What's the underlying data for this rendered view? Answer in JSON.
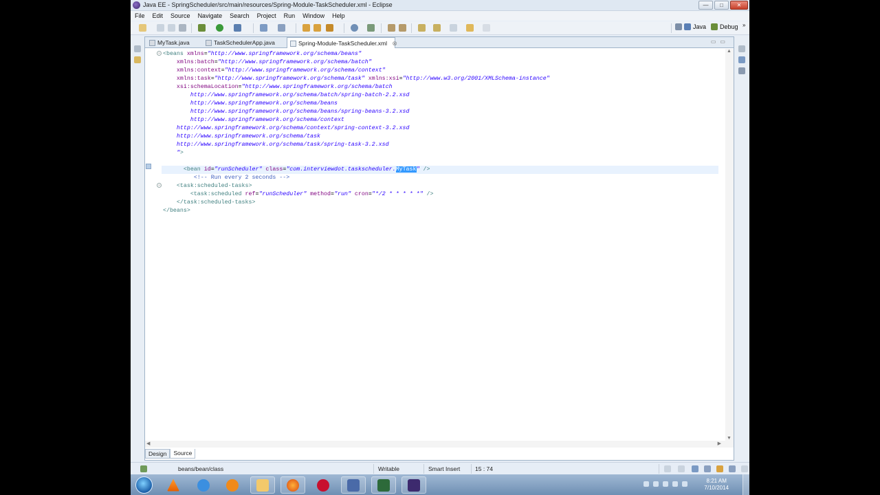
{
  "window": {
    "title": "Java EE - SpringScheduler/src/main/resources/Spring-Module-TaskScheduler.xml - Eclipse",
    "buttons": {
      "minimize": "—",
      "maximize": "□",
      "close": "✕"
    }
  },
  "menu": [
    "File",
    "Edit",
    "Source",
    "Navigate",
    "Search",
    "Project",
    "Run",
    "Window",
    "Help"
  ],
  "perspectives": {
    "java": "Java",
    "debug": "Debug",
    "more": "»"
  },
  "tabs": [
    {
      "label": "MyTask.java"
    },
    {
      "label": "TaskSchedulerApp.java"
    },
    {
      "label": "Spring-Module-TaskScheduler.xml",
      "close": "⊗",
      "active": true
    }
  ],
  "code": {
    "lines": [
      [
        [
          "tag",
          "<beans "
        ],
        [
          "attr",
          "xmlns"
        ],
        [
          "",
          "="
        ],
        [
          "val",
          "\"http://www.springframework.org/schema/beans\""
        ]
      ],
      [
        [
          "",
          "    "
        ],
        [
          "attr",
          "xmlns:batch"
        ],
        [
          "",
          "="
        ],
        [
          "val",
          "\"http://www.springframework.org/schema/batch\""
        ]
      ],
      [
        [
          "",
          "    "
        ],
        [
          "attr",
          "xmlns:context"
        ],
        [
          "",
          "="
        ],
        [
          "val",
          "\"http://www.springframework.org/schema/context\""
        ]
      ],
      [
        [
          "",
          "    "
        ],
        [
          "attr",
          "xmlns:task"
        ],
        [
          "",
          "="
        ],
        [
          "val",
          "\"http://www.springframework.org/schema/task\""
        ],
        [
          "",
          " "
        ],
        [
          "attr",
          "xmlns:xsi"
        ],
        [
          "",
          "="
        ],
        [
          "val",
          "\"http://www.w3.org/2001/XMLSchema-instance\""
        ]
      ],
      [
        [
          "",
          "    "
        ],
        [
          "attr",
          "xsi:schemaLocation"
        ],
        [
          "",
          "="
        ],
        [
          "val",
          "\"http://www.springframework.org/schema/batch"
        ]
      ],
      [
        [
          "",
          "        "
        ],
        [
          "val",
          "http://www.springframework.org/schema/batch/spring-batch-2.2.xsd"
        ]
      ],
      [
        [
          "",
          "        "
        ],
        [
          "val",
          "http://www.springframework.org/schema/beans"
        ]
      ],
      [
        [
          "",
          "        "
        ],
        [
          "val",
          "http://www.springframework.org/schema/beans/spring-beans-3.2.xsd"
        ]
      ],
      [
        [
          "",
          "        "
        ],
        [
          "val",
          "http://www.springframework.org/schema/context"
        ]
      ],
      [
        [
          "",
          "    "
        ],
        [
          "val",
          "http://www.springframework.org/schema/context/spring-context-3.2.xsd"
        ]
      ],
      [
        [
          "",
          "    "
        ],
        [
          "val",
          "http://www.springframework.org/schema/task"
        ]
      ],
      [
        [
          "",
          "    "
        ],
        [
          "val",
          "http://www.springframework.org/schema/task/spring-task-3.2.xsd"
        ]
      ],
      [
        [
          "",
          "    "
        ],
        [
          "val",
          "\""
        ],
        [
          "tag",
          ">"
        ]
      ],
      [],
      [
        [
          "",
          "      "
        ],
        [
          "tag",
          "<bean "
        ],
        [
          "attr",
          "id"
        ],
        [
          "",
          "="
        ],
        [
          "val",
          "\"runScheduler\""
        ],
        [
          "",
          " "
        ],
        [
          "attr",
          "class"
        ],
        [
          "",
          "="
        ],
        [
          "val",
          "\"com.interviewdot.taskscheduler."
        ],
        [
          "sel",
          "MyTask"
        ],
        [
          "val",
          "\""
        ],
        [
          "",
          " "
        ],
        [
          "tag",
          "/>"
        ]
      ],
      [
        [
          "",
          "         "
        ],
        [
          "cmt",
          "<!-- Run every 2 seconds -->"
        ]
      ],
      [
        [
          "",
          "    "
        ],
        [
          "tag",
          "<task:scheduled-tasks>"
        ]
      ],
      [
        [
          "",
          "        "
        ],
        [
          "tag",
          "<task:scheduled "
        ],
        [
          "attr",
          "ref"
        ],
        [
          "",
          "="
        ],
        [
          "val",
          "\"runScheduler\""
        ],
        [
          "",
          " "
        ],
        [
          "attr",
          "method"
        ],
        [
          "",
          "="
        ],
        [
          "val",
          "\"run\""
        ],
        [
          "",
          " "
        ],
        [
          "attr",
          "cron"
        ],
        [
          "",
          "="
        ],
        [
          "val",
          "\"*/2 * * * * *\""
        ],
        [
          "",
          " "
        ],
        [
          "tag",
          "/>"
        ]
      ],
      [
        [
          "",
          "    "
        ],
        [
          "tag",
          "</task:scheduled-tasks>"
        ]
      ],
      [
        [
          "tag",
          "</beans>"
        ]
      ]
    ]
  },
  "editor_modes": [
    "Design",
    "Source"
  ],
  "status": {
    "breadcrumb": "beans/bean/class",
    "mode": "Writable",
    "insert": "Smart Insert",
    "position": "15 : 74"
  },
  "clock": {
    "time": "8:21 AM",
    "date": "7/10/2014"
  },
  "colors": {
    "tag": "#3f7f7f",
    "attribute": "#7f007f",
    "value": "#2a00ff",
    "comment": "#3f5fbf",
    "selection": "#3399ff"
  },
  "taskbar_apps": [
    "start-orb",
    "vlc-icon",
    "internet-explorer-icon",
    "media-player-icon",
    "explorer-icon",
    "firefox-icon",
    "filezilla-icon",
    "save-disk-icon",
    "console-icon",
    "eclipse-icon"
  ]
}
